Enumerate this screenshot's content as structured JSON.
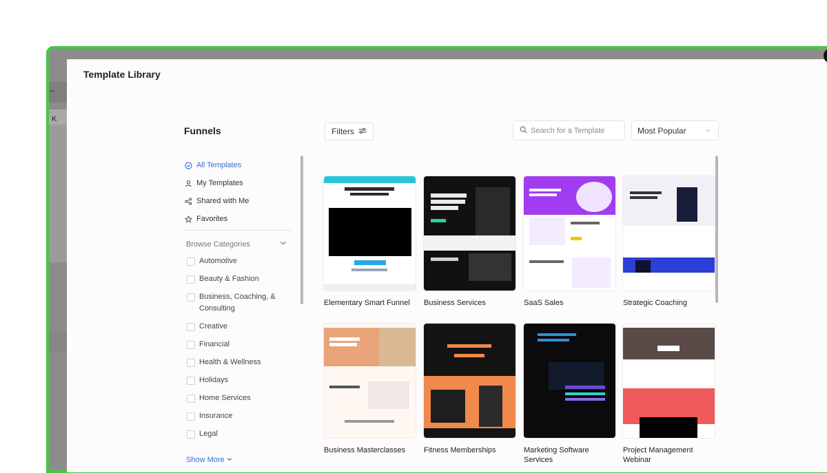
{
  "modal": {
    "title": "Template Library"
  },
  "background": {
    "letter": "K",
    "dash": "–"
  },
  "sidebar": {
    "title": "Funnels",
    "nav": [
      {
        "label": "All Templates",
        "icon": "check-circle-icon",
        "active": true
      },
      {
        "label": "My Templates",
        "icon": "user-icon",
        "active": false
      },
      {
        "label": "Shared with Me",
        "icon": "share-icon",
        "active": false
      },
      {
        "label": "Favorites",
        "icon": "star-icon",
        "active": false
      }
    ],
    "browse_label": "Browse Categories",
    "categories": [
      "Automotive",
      "Beauty & Fashion",
      "Business, Coaching, & Consulting",
      "Creative",
      "Financial",
      "Health & Wellness",
      "Holidays",
      "Home Services",
      "Insurance",
      "Legal"
    ],
    "show_more": "Show More"
  },
  "toolbar": {
    "filters_label": "Filters",
    "search_placeholder": "Search for a Template",
    "sort_value": "Most Popular"
  },
  "templates": [
    {
      "title": "Elementary Smart Funnel"
    },
    {
      "title": "Business Services"
    },
    {
      "title": "SaaS Sales"
    },
    {
      "title": "Strategic Coaching"
    },
    {
      "title": "Business Masterclasses"
    },
    {
      "title": "Fitness Memberships"
    },
    {
      "title": "Marketing Software Services"
    },
    {
      "title": "Project Management Webinar"
    }
  ],
  "colors": {
    "accent": "#2f6fd6",
    "frame_border": "#4cc24a",
    "saas_purple": "#a23cf0",
    "coaching_blue": "#2b3fd6",
    "fitness_orange": "#f08a4b",
    "webinar_red": "#f05a5a"
  }
}
